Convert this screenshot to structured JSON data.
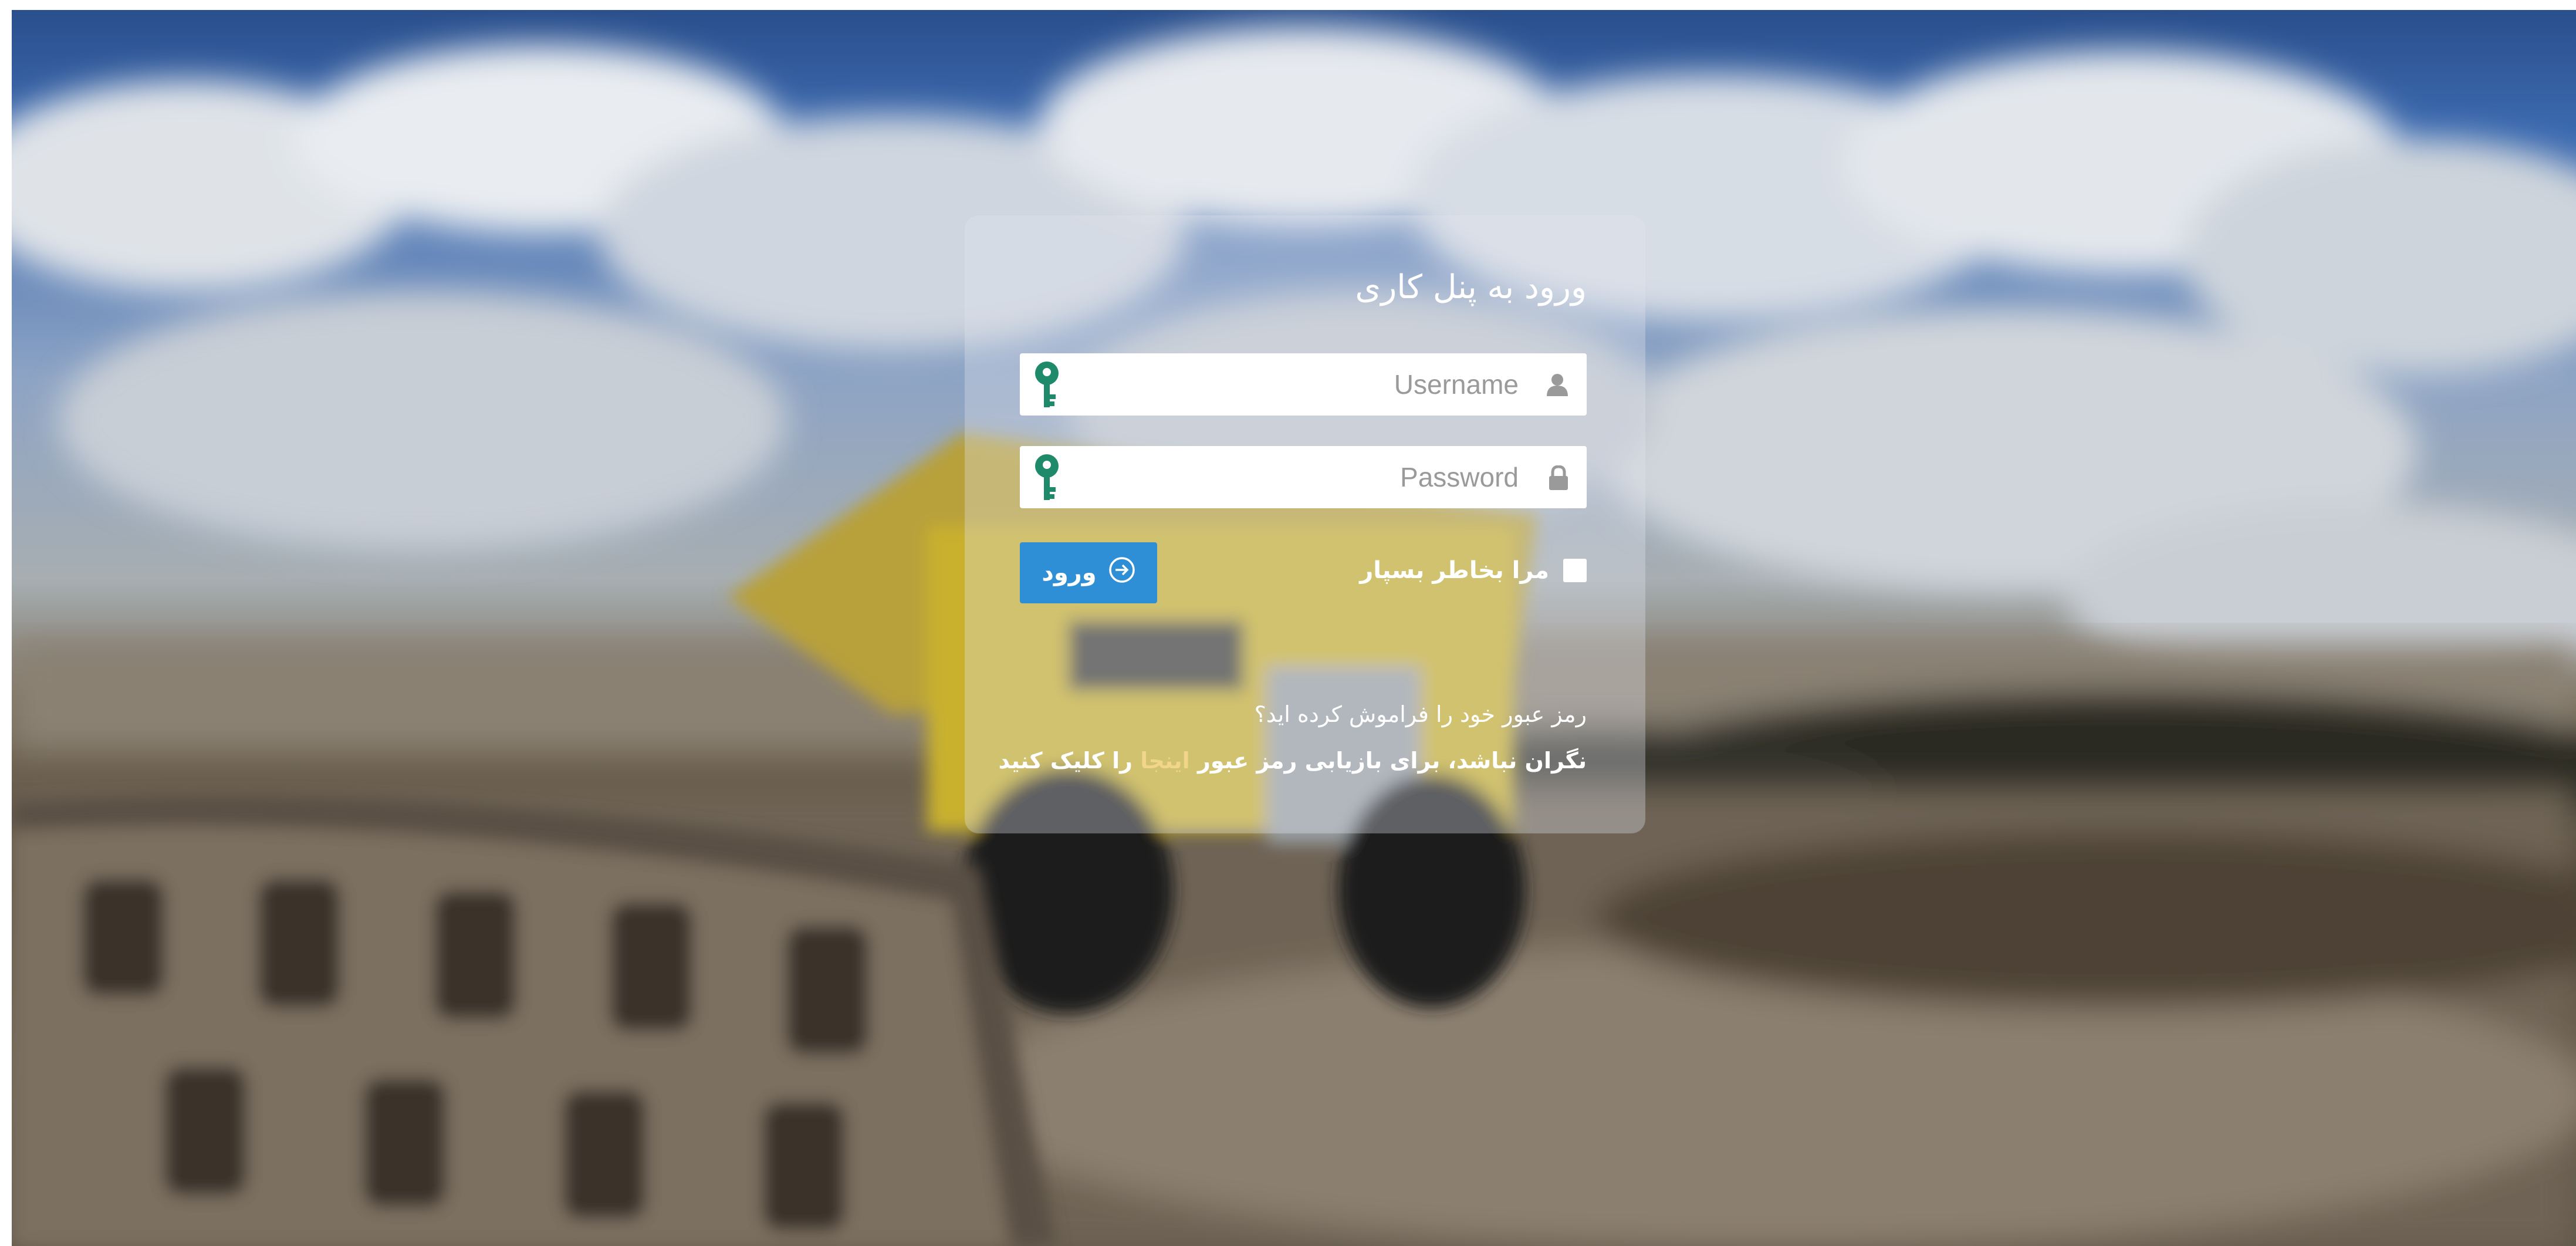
{
  "panel": {
    "title": "ورود به پنل کاری"
  },
  "username": {
    "placeholder": "Username",
    "value": "",
    "left_icon": "key-icon",
    "right_icon": "user-icon"
  },
  "password": {
    "placeholder": "Password",
    "value": "",
    "left_icon": "key-icon",
    "right_icon": "lock-icon"
  },
  "login_button": {
    "label": "ورود",
    "icon": "arrow-circle-right-icon"
  },
  "remember_me": {
    "label": "مرا بخاطر بسپار",
    "checked": false
  },
  "forgot": {
    "question": "رمز عبور خود را فراموش کرده اید؟",
    "line_prefix": "نگران نباشد، برای بازیابی رمز عبور ",
    "link_text": "اینجا",
    "line_suffix": " را کلیک کنید"
  },
  "colors": {
    "button": "#2f8fd6",
    "key_icon": "#1f8a6a",
    "link": "#f0d58a",
    "panel": "rgba(225,230,238,0.34)"
  }
}
